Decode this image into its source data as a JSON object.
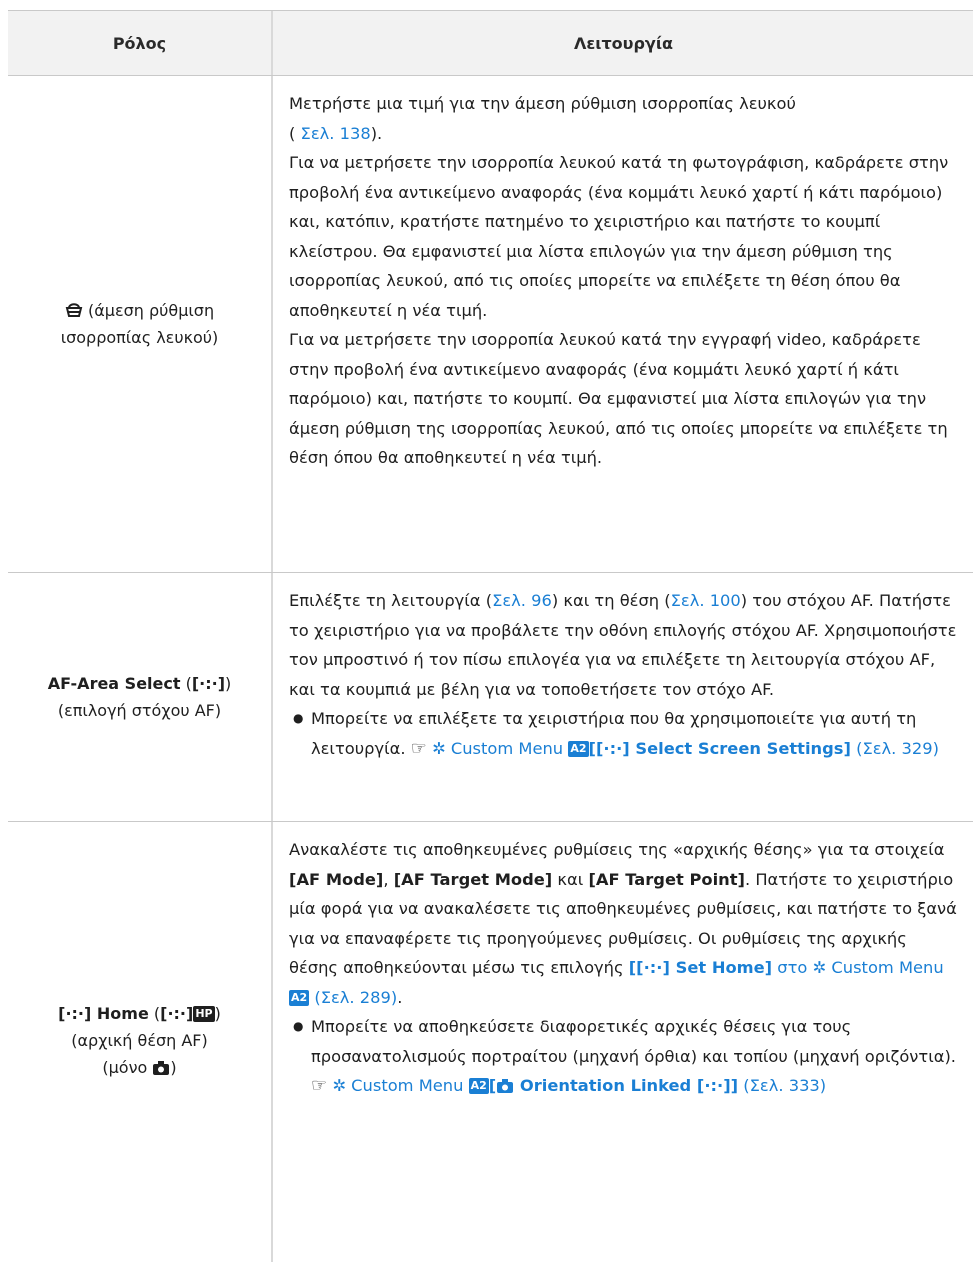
{
  "header": {
    "col1": "Ρόλος",
    "col2": "Λειτουργία"
  },
  "row1": {
    "role_icon": "white-balance-icon",
    "role_text1": "(άμεση ρύθμιση",
    "role_text2": "ισορροπίας λευκού)",
    "p1_line1": "Μετρήστε μια τιμή για την άμεση ρύθμιση ισορροπίας λευκού",
    "p1_paren_open": "(",
    "p1_link": "Σελ. 138",
    "p1_paren_close": ").",
    "p2": "Για να μετρήσετε την ισορροπία λευκού κατά τη φωτογράφιση, καδράρετε στην προβολή ένα αντικείμενο αναφοράς (ένα κομμάτι λευκό χαρτί ή κάτι παρόμοιο) και, κατόπιν, κρατήστε πατημένο το χειριστήριο και πατήστε το κουμπί κλείστρου. Θα εμφανιστεί μια λίστα επιλογών για την άμεση ρύθμιση της ισορροπίας λευκού, από τις οποίες μπορείτε να επιλέξετε τη θέση όπου θα αποθηκευτεί η νέα τιμή.",
    "p3": "Για να μετρήσετε την ισορροπία λευκού κατά την εγγραφή video, καδράρετε στην προβολή ένα αντικείμενο αναφοράς (ένα κομμάτι λευκό χαρτί ή κάτι παρόμοιο) και, πατήστε το κουμπί. Θα εμφανιστεί μια λίστα επιλογών για την άμεση ρύθμιση της ισορροπίας λευκού, από τις οποίες μπορείτε να επιλέξετε τη θέση όπου θα αποθηκευτεί η νέα τιμή."
  },
  "row2": {
    "role_bold": "AF-Area Select",
    "role_open": " (",
    "role_symbol": "[·:·]",
    "role_close": ")",
    "role_sub": "(επιλογή στόχου AF)",
    "t1": "Επιλέξτε τη λειτουργία (",
    "link1": "Σελ. 96",
    "t2": ") και τη θέση (",
    "link2": "Σελ. 100",
    "t3": ") του στόχου AF. Πατήστε το χειριστήριο για να προβάλετε την οθόνη επιλογής στόχου AF. Χρησιμοποιήστε τον μπροστινό ή τον πίσω επιλογέα για να επιλέξετε τη λειτουργία στόχου AF, και τα κουμπιά με βέλη για να τοποθετήσετε τον στόχο AF.",
    "bullet": "Μπορείτε να επιλέξετε τα χειριστήρια που θα χρησιμοποιείτε για αυτή τη λειτουργία.",
    "ref_menu": "Custom Menu",
    "ref_badge": "A2",
    "ref_bold": "[[·:·] Select Screen Settings]",
    "ref_page": "(Σελ. 329)"
  },
  "row3": {
    "role_symbol": "[·:·]",
    "role_bold": " Home",
    "role_open": " (",
    "role_symbol2": "[·:·]",
    "role_hp": "HP",
    "role_close": ")",
    "role_sub1": "(αρχική θέση AF)",
    "role_sub2": "(μόνο ",
    "role_sub2_close": ")",
    "t1": "Ανακαλέστε τις αποθηκευμένες ρυθμίσεις της «αρχικής θέσης» για τα στοιχεία ",
    "b1": "[AF Mode]",
    "t2": ", ",
    "b2": "[AF Target Mode]",
    "t3": " και ",
    "b3": "[AF Target Point]",
    "t4": ". Πατήστε το χειριστήριο μία φορά για να ανακαλέσετε τις αποθηκευμένες ρυθμίσεις, και πατήστε το ξανά για να επαναφέρετε τις προηγούμενες ρυθμίσεις. Οι ρυθμίσεις της αρχικής θέσης αποθηκεύονται μέσω τις επιλογής ",
    "link_bold": "[[·:·] Set Home]",
    "link_sto": " στο",
    "menu": "Custom Menu",
    "badge": "A2",
    "page": "(Σελ. 289)",
    "t5": ".",
    "bullet": "Μπορείτε να αποθηκεύσετε διαφορετικές αρχικές θέσεις για τους προσανατολισμούς πορτραίτου (μηχανή όρθια) και τοπίου (μηχανή οριζόντια).",
    "ref_menu": "Custom Menu",
    "ref_badge": "A2",
    "ref_open": "[",
    "ref_bold": " Orientation Linked [·:·]]",
    "ref_page": "(Σελ. 333)"
  },
  "colors": {
    "link": "#1a7fd4",
    "header_bg": "#f2f2f2",
    "border": "#c9c9c9"
  }
}
